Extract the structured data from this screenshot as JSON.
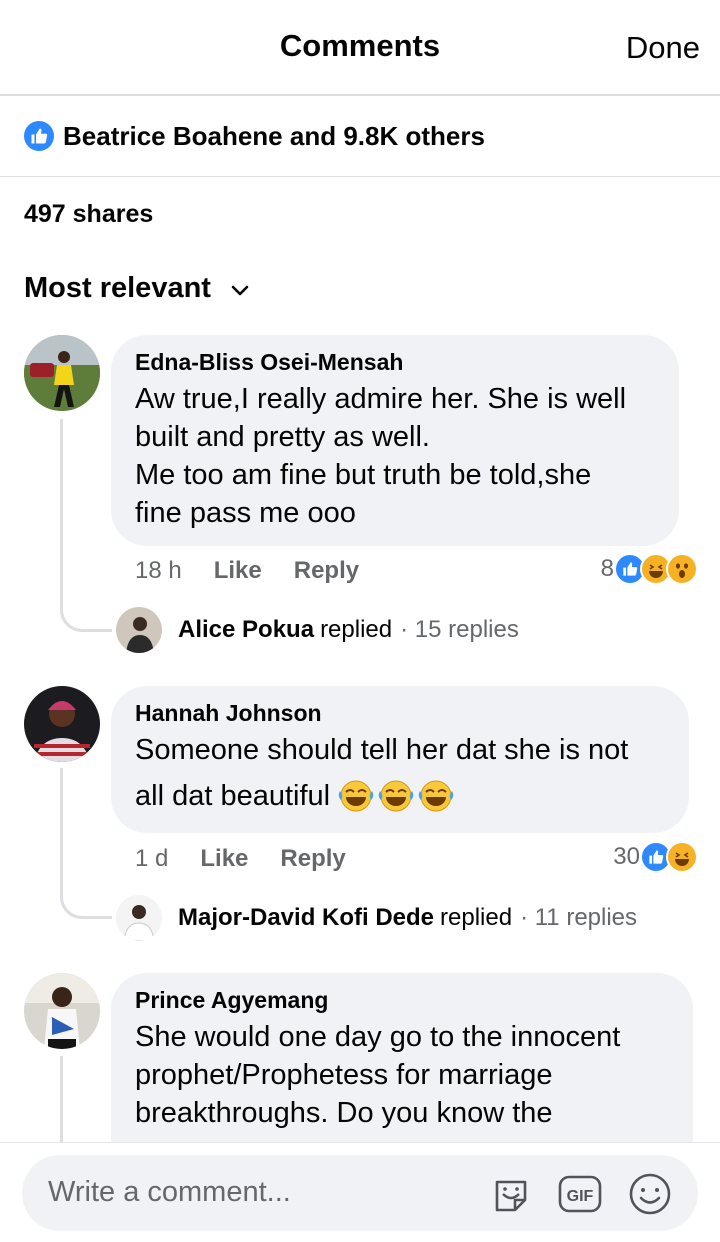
{
  "header": {
    "title": "Comments",
    "done_label": "Done"
  },
  "likes": {
    "icon": "like-icon",
    "text": "Beatrice Boahene and 9.8K others"
  },
  "shares": {
    "text": "497 shares"
  },
  "sort": {
    "label": "Most relevant",
    "icon": "chevron-down-icon"
  },
  "comments": [
    {
      "author": "Edna-Bliss Osei-Mensah",
      "text": "Aw true,I really admire her. She is well\nbuilt and pretty as well.\nMe too am fine but truth be told,she\nfine pass me ooo",
      "time": "18 h",
      "like_label": "Like",
      "reply_label": "Reply",
      "reaction_count": "8",
      "reactions": [
        "like",
        "haha",
        "wow"
      ],
      "replies": {
        "name": "Alice Pokua",
        "replied_word": "replied",
        "count_text": "· 15 replies"
      }
    },
    {
      "author": "Hannah Johnson",
      "text_line1": "Someone should tell her dat she is not",
      "text_line2": "all dat beautiful",
      "emojis": [
        "laughing-tears",
        "laughing-tears",
        "laughing-tears"
      ],
      "time": "1 d",
      "like_label": "Like",
      "reply_label": "Reply",
      "reaction_count": "30",
      "reactions": [
        "like",
        "haha"
      ],
      "replies": {
        "name": "Major-David Kofi Dede",
        "replied_word": "replied",
        "count_text": "· 11 replies"
      }
    },
    {
      "author": "Prince Agyemang",
      "text": "She would one day go to the innocent\nprophet/Prophetess for marriage\nbreakthroughs. Do you know the"
    }
  ],
  "composer": {
    "placeholder": "Write a comment...",
    "icons": [
      "sticker-icon",
      "gif-icon",
      "emoji-icon"
    ]
  },
  "colors": {
    "accent": "#2e89ff",
    "bubble": "#f0f2f5",
    "secondary_text": "#65676b",
    "haha_yellow": "#f7b125"
  }
}
